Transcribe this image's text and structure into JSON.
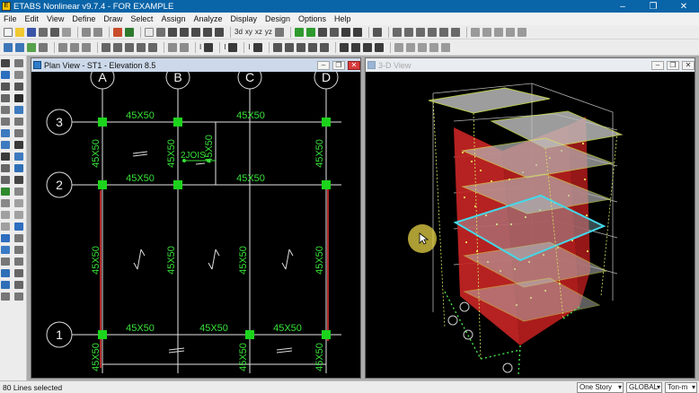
{
  "app": {
    "title": "ETABS Nonlinear v9.7.4 - FOR EXAMPLE",
    "window_buttons": [
      "–",
      "❐",
      "✕"
    ]
  },
  "menu": [
    "File",
    "Edit",
    "View",
    "Define",
    "Draw",
    "Select",
    "Assign",
    "Analyze",
    "Display",
    "Design",
    "Options",
    "Help"
  ],
  "toolbar": {
    "row1_texts": [
      "3d",
      "xy",
      "xz",
      "yz"
    ],
    "row2_texts": [
      "I",
      "I",
      "I"
    ]
  },
  "plan_view": {
    "title": "Plan View - ST1 - Elevation 8.5",
    "buttons": [
      "–",
      "❐",
      "✕"
    ],
    "grid_columns": [
      "A",
      "B",
      "C",
      "D"
    ],
    "grid_rows": [
      "3",
      "2",
      "1"
    ],
    "beam_labels_h": [
      "45X50",
      "45X50",
      "45X50",
      "45X50",
      "45X50",
      "45X50",
      "45X50"
    ],
    "beam_labels_v": [
      "45X50",
      "45X50",
      "45X50",
      "45X50",
      "45X50",
      "45X50",
      "45X50",
      "45X50",
      "45X50",
      "45X50",
      "45X50"
    ],
    "joist_label": "2JOIS",
    "colors": {
      "beam": "#38e038",
      "grid": "#e6e6e6",
      "wall": "#b02a2a",
      "column": "#1cd41c"
    }
  },
  "view3d": {
    "title": "3-D View",
    "buttons": [
      "–",
      "❐",
      "✕"
    ],
    "colors": {
      "wall": "#c62424",
      "slab": "#b9b9b9",
      "highlight": "#44d8e8",
      "frame": "#d8e860"
    }
  },
  "status": {
    "text": "80 Lines selected",
    "story_dropdown": "One Story",
    "coord_dropdown": "GLOBAL",
    "units_dropdown": "Ton-m"
  }
}
